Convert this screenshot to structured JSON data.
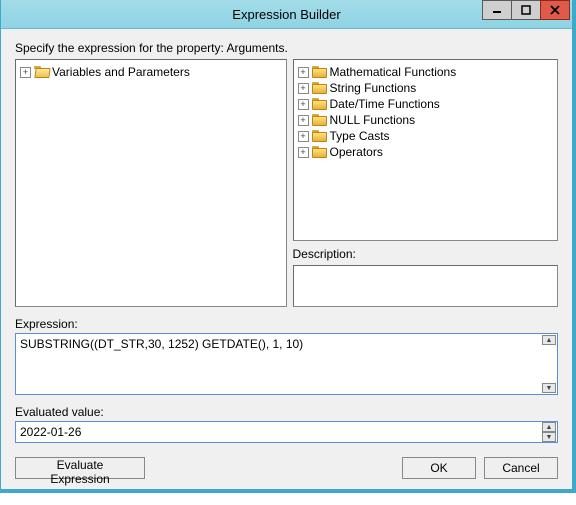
{
  "window": {
    "title": "Expression Builder"
  },
  "instruction": "Specify the expression for the property: Arguments.",
  "left_tree": {
    "items": [
      {
        "label": "Variables and Parameters"
      }
    ]
  },
  "right_tree": {
    "items": [
      {
        "label": "Mathematical Functions"
      },
      {
        "label": "String Functions"
      },
      {
        "label": "Date/Time Functions"
      },
      {
        "label": "NULL Functions"
      },
      {
        "label": "Type Casts"
      },
      {
        "label": "Operators"
      }
    ]
  },
  "labels": {
    "description": "Description:",
    "expression": "Expression:",
    "evaluated": "Evaluated value:"
  },
  "expression": {
    "value": "SUBSTRING((DT_STR,30, 1252) GETDATE(), 1, 10)"
  },
  "evaluated": {
    "value": "2022-01-26"
  },
  "buttons": {
    "evaluate": "Evaluate Expression",
    "ok": "OK",
    "cancel": "Cancel"
  }
}
